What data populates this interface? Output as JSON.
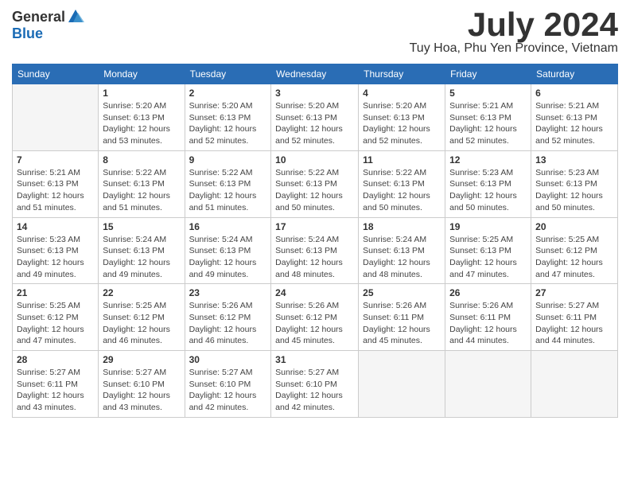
{
  "logo": {
    "general": "General",
    "blue": "Blue"
  },
  "title": "July 2024",
  "location": "Tuy Hoa, Phu Yen Province, Vietnam",
  "days_of_week": [
    "Sunday",
    "Monday",
    "Tuesday",
    "Wednesday",
    "Thursday",
    "Friday",
    "Saturday"
  ],
  "weeks": [
    [
      {
        "day": "",
        "info": ""
      },
      {
        "day": "1",
        "info": "Sunrise: 5:20 AM\nSunset: 6:13 PM\nDaylight: 12 hours\nand 53 minutes."
      },
      {
        "day": "2",
        "info": "Sunrise: 5:20 AM\nSunset: 6:13 PM\nDaylight: 12 hours\nand 52 minutes."
      },
      {
        "day": "3",
        "info": "Sunrise: 5:20 AM\nSunset: 6:13 PM\nDaylight: 12 hours\nand 52 minutes."
      },
      {
        "day": "4",
        "info": "Sunrise: 5:20 AM\nSunset: 6:13 PM\nDaylight: 12 hours\nand 52 minutes."
      },
      {
        "day": "5",
        "info": "Sunrise: 5:21 AM\nSunset: 6:13 PM\nDaylight: 12 hours\nand 52 minutes."
      },
      {
        "day": "6",
        "info": "Sunrise: 5:21 AM\nSunset: 6:13 PM\nDaylight: 12 hours\nand 52 minutes."
      }
    ],
    [
      {
        "day": "7",
        "info": "Sunrise: 5:21 AM\nSunset: 6:13 PM\nDaylight: 12 hours\nand 51 minutes."
      },
      {
        "day": "8",
        "info": "Sunrise: 5:22 AM\nSunset: 6:13 PM\nDaylight: 12 hours\nand 51 minutes."
      },
      {
        "day": "9",
        "info": "Sunrise: 5:22 AM\nSunset: 6:13 PM\nDaylight: 12 hours\nand 51 minutes."
      },
      {
        "day": "10",
        "info": "Sunrise: 5:22 AM\nSunset: 6:13 PM\nDaylight: 12 hours\nand 50 minutes."
      },
      {
        "day": "11",
        "info": "Sunrise: 5:22 AM\nSunset: 6:13 PM\nDaylight: 12 hours\nand 50 minutes."
      },
      {
        "day": "12",
        "info": "Sunrise: 5:23 AM\nSunset: 6:13 PM\nDaylight: 12 hours\nand 50 minutes."
      },
      {
        "day": "13",
        "info": "Sunrise: 5:23 AM\nSunset: 6:13 PM\nDaylight: 12 hours\nand 50 minutes."
      }
    ],
    [
      {
        "day": "14",
        "info": "Sunrise: 5:23 AM\nSunset: 6:13 PM\nDaylight: 12 hours\nand 49 minutes."
      },
      {
        "day": "15",
        "info": "Sunrise: 5:24 AM\nSunset: 6:13 PM\nDaylight: 12 hours\nand 49 minutes."
      },
      {
        "day": "16",
        "info": "Sunrise: 5:24 AM\nSunset: 6:13 PM\nDaylight: 12 hours\nand 49 minutes."
      },
      {
        "day": "17",
        "info": "Sunrise: 5:24 AM\nSunset: 6:13 PM\nDaylight: 12 hours\nand 48 minutes."
      },
      {
        "day": "18",
        "info": "Sunrise: 5:24 AM\nSunset: 6:13 PM\nDaylight: 12 hours\nand 48 minutes."
      },
      {
        "day": "19",
        "info": "Sunrise: 5:25 AM\nSunset: 6:13 PM\nDaylight: 12 hours\nand 47 minutes."
      },
      {
        "day": "20",
        "info": "Sunrise: 5:25 AM\nSunset: 6:12 PM\nDaylight: 12 hours\nand 47 minutes."
      }
    ],
    [
      {
        "day": "21",
        "info": "Sunrise: 5:25 AM\nSunset: 6:12 PM\nDaylight: 12 hours\nand 47 minutes."
      },
      {
        "day": "22",
        "info": "Sunrise: 5:25 AM\nSunset: 6:12 PM\nDaylight: 12 hours\nand 46 minutes."
      },
      {
        "day": "23",
        "info": "Sunrise: 5:26 AM\nSunset: 6:12 PM\nDaylight: 12 hours\nand 46 minutes."
      },
      {
        "day": "24",
        "info": "Sunrise: 5:26 AM\nSunset: 6:12 PM\nDaylight: 12 hours\nand 45 minutes."
      },
      {
        "day": "25",
        "info": "Sunrise: 5:26 AM\nSunset: 6:11 PM\nDaylight: 12 hours\nand 45 minutes."
      },
      {
        "day": "26",
        "info": "Sunrise: 5:26 AM\nSunset: 6:11 PM\nDaylight: 12 hours\nand 44 minutes."
      },
      {
        "day": "27",
        "info": "Sunrise: 5:27 AM\nSunset: 6:11 PM\nDaylight: 12 hours\nand 44 minutes."
      }
    ],
    [
      {
        "day": "28",
        "info": "Sunrise: 5:27 AM\nSunset: 6:11 PM\nDaylight: 12 hours\nand 43 minutes."
      },
      {
        "day": "29",
        "info": "Sunrise: 5:27 AM\nSunset: 6:10 PM\nDaylight: 12 hours\nand 43 minutes."
      },
      {
        "day": "30",
        "info": "Sunrise: 5:27 AM\nSunset: 6:10 PM\nDaylight: 12 hours\nand 42 minutes."
      },
      {
        "day": "31",
        "info": "Sunrise: 5:27 AM\nSunset: 6:10 PM\nDaylight: 12 hours\nand 42 minutes."
      },
      {
        "day": "",
        "info": ""
      },
      {
        "day": "",
        "info": ""
      },
      {
        "day": "",
        "info": ""
      }
    ]
  ]
}
